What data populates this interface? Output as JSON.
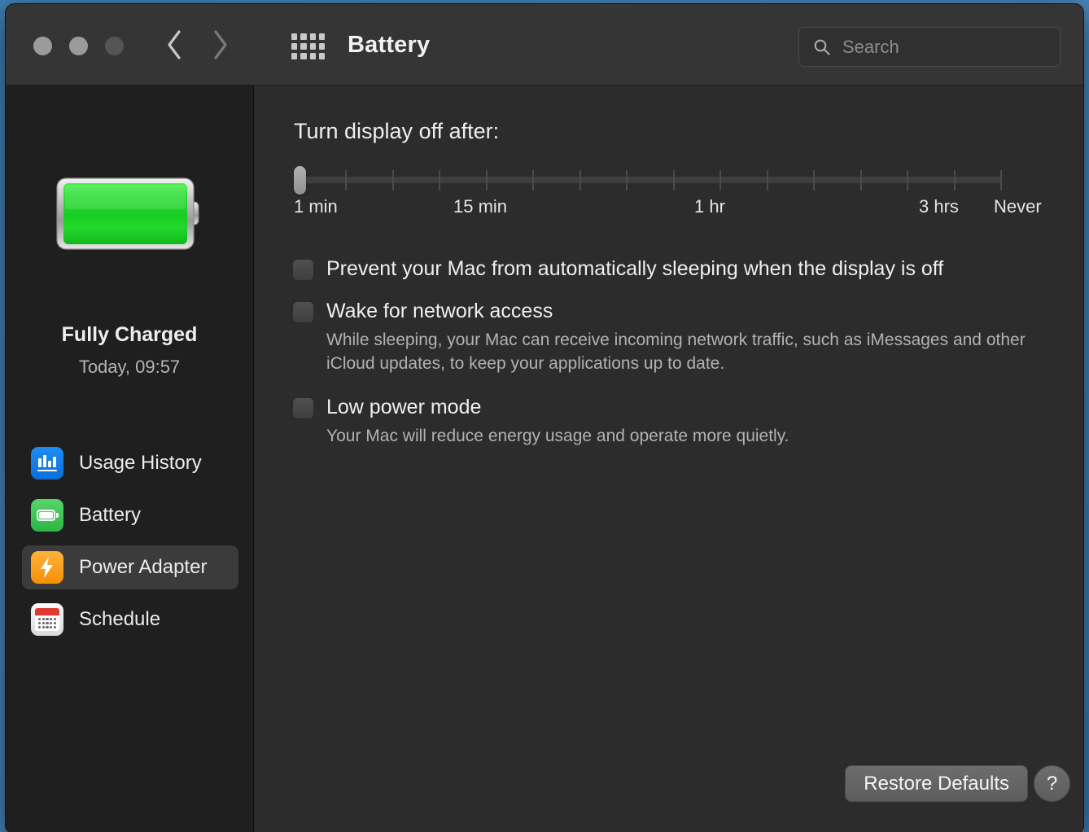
{
  "window": {
    "title": "Battery",
    "traffic_lights": [
      "close",
      "minimize",
      "zoom"
    ]
  },
  "toolbar": {
    "back_icon": "chevron-left-icon",
    "forward_icon": "chevron-right-icon",
    "grid_icon": "grid-icon",
    "search": {
      "placeholder": "Search",
      "value": "",
      "icon": "search-icon"
    }
  },
  "sidebar": {
    "battery_icon": "battery-full-icon",
    "status_title": "Fully Charged",
    "status_sub": "Today, 09:57",
    "items": [
      {
        "label": "Usage History",
        "icon": "bar-chart-icon",
        "selected": false
      },
      {
        "label": "Battery",
        "icon": "battery-icon",
        "selected": false
      },
      {
        "label": "Power Adapter",
        "icon": "power-bolt-icon",
        "selected": true
      },
      {
        "label": "Schedule",
        "icon": "calendar-icon",
        "selected": false
      }
    ]
  },
  "main": {
    "slider": {
      "label": "Turn display off after:",
      "value_index": 0,
      "tick_count": 16,
      "scale": [
        {
          "text": "1 min",
          "pos": 0
        },
        {
          "text": "15 min",
          "pos": 196
        },
        {
          "text": "1 hr",
          "pos": 492
        },
        {
          "text": "3 hrs",
          "pos": 768
        },
        {
          "text": "Never",
          "pos": 860
        }
      ]
    },
    "options": [
      {
        "label": "Prevent your Mac from automatically sleeping when the display is off",
        "checked": false,
        "description": ""
      },
      {
        "label": "Wake for network access",
        "checked": false,
        "description": "While sleeping, your Mac can receive incoming network traffic, such as iMessages and other iCloud updates, to keep your applications up to date."
      },
      {
        "label": "Low power mode",
        "checked": false,
        "description": "Your Mac will reduce energy usage and operate more quietly."
      }
    ],
    "restore_label": "Restore Defaults",
    "help_label": "?"
  },
  "colors": {
    "accent_blue": "#1f8df3",
    "battery_green": "#37d23f",
    "power_orange": "#ffa21e",
    "calendar_red": "#e0392f",
    "desktop": "#3f7fb5"
  }
}
